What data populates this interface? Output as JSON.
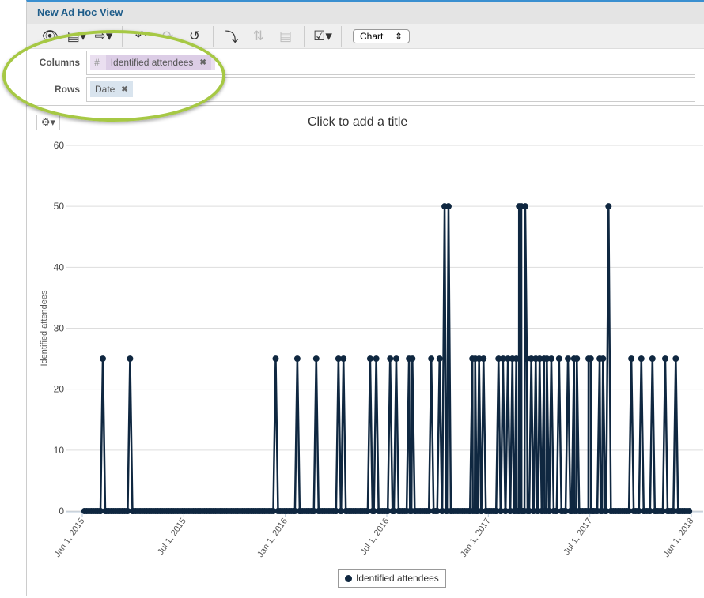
{
  "header": {
    "title": "New Ad Hoc View"
  },
  "toolbar": {
    "icons": [
      "eye-icon",
      "save-icon",
      "export-icon",
      "undo-icon",
      "redo-icon",
      "reset-icon",
      "switch-axes-icon",
      "sort-icon",
      "table-icon",
      "options-icon"
    ],
    "chart_type": "Chart"
  },
  "fields": {
    "columns_label": "Columns",
    "columns_pill": "Identified attendees",
    "columns_prefix": "#",
    "rows_label": "Rows",
    "rows_pill": "Date"
  },
  "chart_title_placeholder": "Click to add a title",
  "chart_data": {
    "type": "line",
    "ylabel": "Identified attendees",
    "ylim": [
      0,
      60
    ],
    "yticks": [
      0,
      10,
      20,
      30,
      40,
      50,
      60
    ],
    "xlim": [
      "2015-01-01",
      "2018-01-01"
    ],
    "xticks": [
      "Jan 1, 2015",
      "Jul 1, 2015",
      "Jan 1, 2016",
      "Jul 1, 2016",
      "Jan 1, 2017",
      "Jul 1, 2017",
      "Jan 1, 2018"
    ],
    "grid": true,
    "legend": "bottom-center",
    "color": "#0f2740",
    "series": [
      {
        "name": "Identified attendees",
        "baseline_value": 0,
        "nonzero_points": [
          [
            "2015-02-07",
            25
          ],
          [
            "2015-03-28",
            25
          ],
          [
            "2015-12-15",
            25
          ],
          [
            "2016-01-23",
            25
          ],
          [
            "2016-02-26",
            25
          ],
          [
            "2016-04-06",
            25
          ],
          [
            "2016-04-15",
            25
          ],
          [
            "2016-06-02",
            25
          ],
          [
            "2016-06-13",
            25
          ],
          [
            "2016-07-08",
            25
          ],
          [
            "2016-07-19",
            25
          ],
          [
            "2016-08-11",
            25
          ],
          [
            "2016-08-17",
            25
          ],
          [
            "2016-09-20",
            25
          ],
          [
            "2016-10-05",
            25
          ],
          [
            "2016-10-14",
            50
          ],
          [
            "2016-10-21",
            50
          ],
          [
            "2016-12-03",
            25
          ],
          [
            "2016-12-08",
            25
          ],
          [
            "2016-12-15",
            25
          ],
          [
            "2016-12-23",
            25
          ],
          [
            "2017-01-19",
            25
          ],
          [
            "2017-01-27",
            25
          ],
          [
            "2017-02-05",
            25
          ],
          [
            "2017-02-13",
            25
          ],
          [
            "2017-02-20",
            25
          ],
          [
            "2017-02-25",
            50
          ],
          [
            "2017-03-01",
            50
          ],
          [
            "2017-03-08",
            50
          ],
          [
            "2017-03-11",
            25
          ],
          [
            "2017-03-19",
            25
          ],
          [
            "2017-03-27",
            25
          ],
          [
            "2017-04-03",
            25
          ],
          [
            "2017-04-11",
            25
          ],
          [
            "2017-04-16",
            25
          ],
          [
            "2017-04-24",
            25
          ],
          [
            "2017-05-08",
            25
          ],
          [
            "2017-05-24",
            25
          ],
          [
            "2017-06-04",
            25
          ],
          [
            "2017-06-09",
            25
          ],
          [
            "2017-06-30",
            25
          ],
          [
            "2017-07-04",
            25
          ],
          [
            "2017-07-20",
            25
          ],
          [
            "2017-07-26",
            25
          ],
          [
            "2017-08-05",
            50
          ],
          [
            "2017-09-15",
            25
          ],
          [
            "2017-10-03",
            25
          ],
          [
            "2017-10-23",
            25
          ],
          [
            "2017-11-15",
            25
          ],
          [
            "2017-12-04",
            25
          ]
        ]
      }
    ]
  }
}
